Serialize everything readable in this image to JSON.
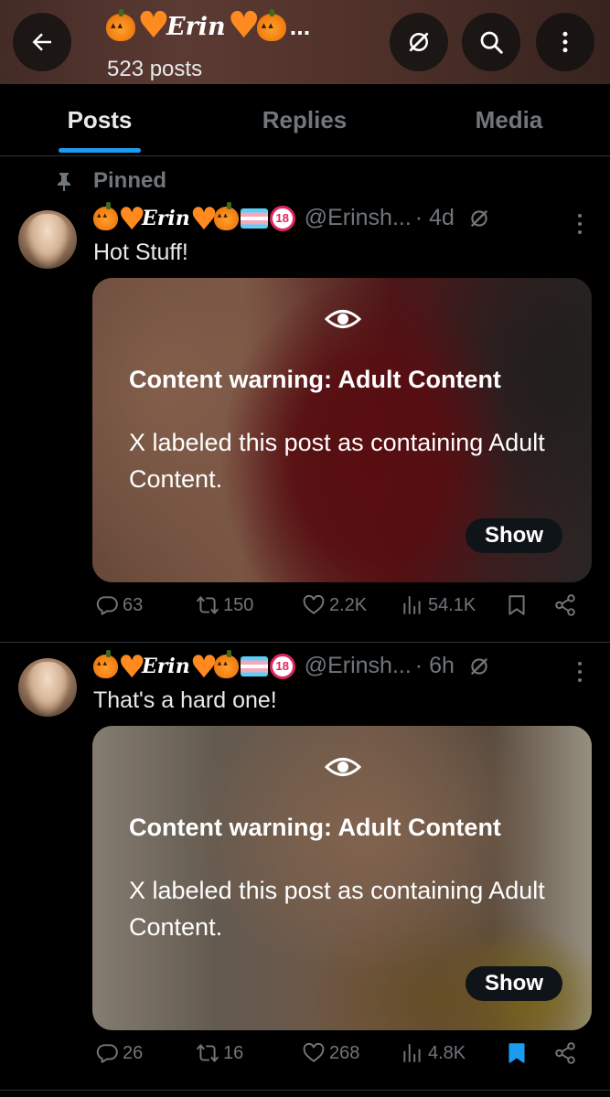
{
  "header": {
    "name": "Erin",
    "post_count": "523 posts",
    "overflow": "..."
  },
  "tabs": [
    {
      "label": "Posts",
      "active": true
    },
    {
      "label": "Replies",
      "active": false
    },
    {
      "label": "Media",
      "active": false
    }
  ],
  "pinned_label": "Pinned",
  "posts": [
    {
      "display_name": "Erin",
      "badge": "18",
      "handle": "@Erinsh...",
      "time": "· 4d",
      "text": "Hot Stuff!",
      "warning_title": "Content warning: Adult Content",
      "warning_body": "X labeled this post as containing Adult Content.",
      "show_label": "Show",
      "replies": "63",
      "reposts": "150",
      "likes": "2.2K",
      "views": "54.1K",
      "bookmarked": false
    },
    {
      "display_name": "Erin",
      "badge": "18",
      "handle": "@Erinsh...",
      "time": "· 6h",
      "text": "That's a hard one!",
      "warning_title": "Content warning: Adult Content",
      "warning_body": "X labeled this post as containing Adult Content.",
      "show_label": "Show",
      "replies": "26",
      "reposts": "16",
      "likes": "268",
      "views": "4.8K",
      "bookmarked": true
    }
  ],
  "colors": {
    "accent": "#1d9bf0",
    "muted": "#71767b",
    "background": "#000000"
  },
  "icons": [
    "back-arrow-icon",
    "grok-icon",
    "search-icon",
    "more-vertical-icon",
    "pin-icon",
    "eye-icon",
    "reply-icon",
    "repost-icon",
    "like-icon",
    "views-icon",
    "bookmark-icon",
    "share-icon"
  ]
}
